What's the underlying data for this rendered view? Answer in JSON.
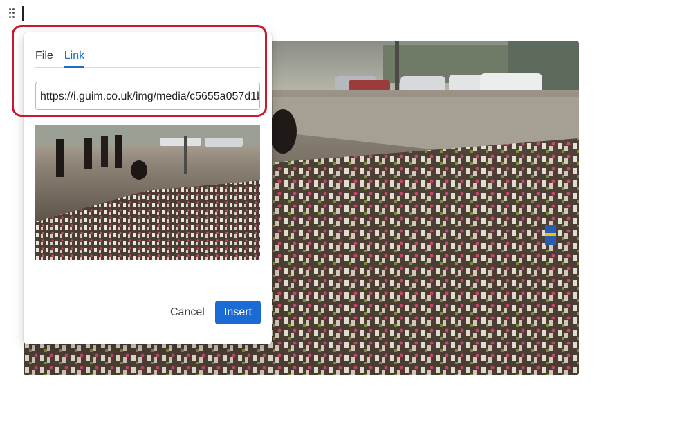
{
  "editor": {
    "drag_handle_icon": "drag-handle-icon"
  },
  "image_block": {
    "alt": ""
  },
  "dialog": {
    "tabs": [
      {
        "label": "File",
        "active": false
      },
      {
        "label": "Link",
        "active": true
      }
    ],
    "url_value": "https://i.guim.co.uk/img/media/c5655a057d1b",
    "cancel_label": "Cancel",
    "insert_label": "Insert"
  },
  "colors": {
    "accent": "#1a6bd6",
    "highlight": "#c8192d"
  }
}
